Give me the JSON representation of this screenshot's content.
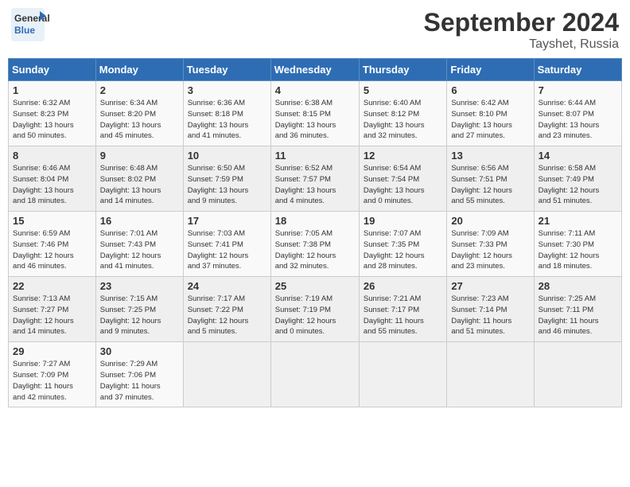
{
  "header": {
    "logo_general": "General",
    "logo_blue": "Blue",
    "month_title": "September 2024",
    "location": "Tayshet, Russia"
  },
  "weekdays": [
    "Sunday",
    "Monday",
    "Tuesday",
    "Wednesday",
    "Thursday",
    "Friday",
    "Saturday"
  ],
  "weeks": [
    [
      {
        "day": "1",
        "info": "Sunrise: 6:32 AM\nSunset: 8:23 PM\nDaylight: 13 hours\nand 50 minutes."
      },
      {
        "day": "2",
        "info": "Sunrise: 6:34 AM\nSunset: 8:20 PM\nDaylight: 13 hours\nand 45 minutes."
      },
      {
        "day": "3",
        "info": "Sunrise: 6:36 AM\nSunset: 8:18 PM\nDaylight: 13 hours\nand 41 minutes."
      },
      {
        "day": "4",
        "info": "Sunrise: 6:38 AM\nSunset: 8:15 PM\nDaylight: 13 hours\nand 36 minutes."
      },
      {
        "day": "5",
        "info": "Sunrise: 6:40 AM\nSunset: 8:12 PM\nDaylight: 13 hours\nand 32 minutes."
      },
      {
        "day": "6",
        "info": "Sunrise: 6:42 AM\nSunset: 8:10 PM\nDaylight: 13 hours\nand 27 minutes."
      },
      {
        "day": "7",
        "info": "Sunrise: 6:44 AM\nSunset: 8:07 PM\nDaylight: 13 hours\nand 23 minutes."
      }
    ],
    [
      {
        "day": "8",
        "info": "Sunrise: 6:46 AM\nSunset: 8:04 PM\nDaylight: 13 hours\nand 18 minutes."
      },
      {
        "day": "9",
        "info": "Sunrise: 6:48 AM\nSunset: 8:02 PM\nDaylight: 13 hours\nand 14 minutes."
      },
      {
        "day": "10",
        "info": "Sunrise: 6:50 AM\nSunset: 7:59 PM\nDaylight: 13 hours\nand 9 minutes."
      },
      {
        "day": "11",
        "info": "Sunrise: 6:52 AM\nSunset: 7:57 PM\nDaylight: 13 hours\nand 4 minutes."
      },
      {
        "day": "12",
        "info": "Sunrise: 6:54 AM\nSunset: 7:54 PM\nDaylight: 13 hours\nand 0 minutes."
      },
      {
        "day": "13",
        "info": "Sunrise: 6:56 AM\nSunset: 7:51 PM\nDaylight: 12 hours\nand 55 minutes."
      },
      {
        "day": "14",
        "info": "Sunrise: 6:58 AM\nSunset: 7:49 PM\nDaylight: 12 hours\nand 51 minutes."
      }
    ],
    [
      {
        "day": "15",
        "info": "Sunrise: 6:59 AM\nSunset: 7:46 PM\nDaylight: 12 hours\nand 46 minutes."
      },
      {
        "day": "16",
        "info": "Sunrise: 7:01 AM\nSunset: 7:43 PM\nDaylight: 12 hours\nand 41 minutes."
      },
      {
        "day": "17",
        "info": "Sunrise: 7:03 AM\nSunset: 7:41 PM\nDaylight: 12 hours\nand 37 minutes."
      },
      {
        "day": "18",
        "info": "Sunrise: 7:05 AM\nSunset: 7:38 PM\nDaylight: 12 hours\nand 32 minutes."
      },
      {
        "day": "19",
        "info": "Sunrise: 7:07 AM\nSunset: 7:35 PM\nDaylight: 12 hours\nand 28 minutes."
      },
      {
        "day": "20",
        "info": "Sunrise: 7:09 AM\nSunset: 7:33 PM\nDaylight: 12 hours\nand 23 minutes."
      },
      {
        "day": "21",
        "info": "Sunrise: 7:11 AM\nSunset: 7:30 PM\nDaylight: 12 hours\nand 18 minutes."
      }
    ],
    [
      {
        "day": "22",
        "info": "Sunrise: 7:13 AM\nSunset: 7:27 PM\nDaylight: 12 hours\nand 14 minutes."
      },
      {
        "day": "23",
        "info": "Sunrise: 7:15 AM\nSunset: 7:25 PM\nDaylight: 12 hours\nand 9 minutes."
      },
      {
        "day": "24",
        "info": "Sunrise: 7:17 AM\nSunset: 7:22 PM\nDaylight: 12 hours\nand 5 minutes."
      },
      {
        "day": "25",
        "info": "Sunrise: 7:19 AM\nSunset: 7:19 PM\nDaylight: 12 hours\nand 0 minutes."
      },
      {
        "day": "26",
        "info": "Sunrise: 7:21 AM\nSunset: 7:17 PM\nDaylight: 11 hours\nand 55 minutes."
      },
      {
        "day": "27",
        "info": "Sunrise: 7:23 AM\nSunset: 7:14 PM\nDaylight: 11 hours\nand 51 minutes."
      },
      {
        "day": "28",
        "info": "Sunrise: 7:25 AM\nSunset: 7:11 PM\nDaylight: 11 hours\nand 46 minutes."
      }
    ],
    [
      {
        "day": "29",
        "info": "Sunrise: 7:27 AM\nSunset: 7:09 PM\nDaylight: 11 hours\nand 42 minutes."
      },
      {
        "day": "30",
        "info": "Sunrise: 7:29 AM\nSunset: 7:06 PM\nDaylight: 11 hours\nand 37 minutes."
      },
      {
        "day": "",
        "info": ""
      },
      {
        "day": "",
        "info": ""
      },
      {
        "day": "",
        "info": ""
      },
      {
        "day": "",
        "info": ""
      },
      {
        "day": "",
        "info": ""
      }
    ]
  ]
}
